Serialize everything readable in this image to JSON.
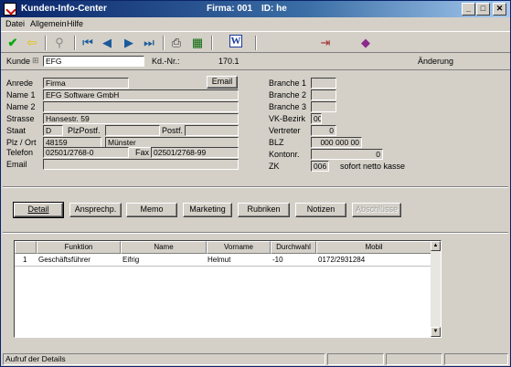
{
  "window": {
    "title": "Kunden-Info-Center",
    "firma": "Firma: 001",
    "id": "ID: he",
    "buttons": [
      "_",
      "□",
      "✕"
    ]
  },
  "menu": [
    "Datei",
    "Allgemein",
    "Hilfe"
  ],
  "header": {
    "kunde_label": "Kunde",
    "kunde_value": "EFG",
    "kdnr_label": "Kd.-Nr.:",
    "kdnr_value": "170.1",
    "mode": "Änderung"
  },
  "form": {
    "anrede_label": "Anrede",
    "anrede": "Firma",
    "email_button": "Email",
    "name1_label": "Name 1",
    "name1": "EFG Software GmbH",
    "name2_label": "Name 2",
    "name2": "",
    "strasse_label": "Strasse",
    "strasse": "Hansestr. 59",
    "staat_label": "Staat",
    "staat": "D",
    "plzpostf_label": "PlzPostf.",
    "plzpostf": "",
    "postf_label": "Postf.",
    "postf": "",
    "plzort_label": "Plz / Ort",
    "plz": "48159",
    "ort": "Münster",
    "telefon_label": "Telefon",
    "telefon": "02501/2768-0",
    "fax_label": "Fax",
    "fax": "02501/2768-99",
    "email_label": "Email",
    "email": "",
    "branche1_label": "Branche 1",
    "branche1": "",
    "branche2_label": "Branche 2",
    "branche2": "",
    "branche3_label": "Branche 3",
    "branche3": "",
    "vkbezirk_label": "VK-Bezirk",
    "vkbezirk": "00",
    "vertreter_label": "Vertreter",
    "vertreter": "0",
    "blz_label": "BLZ",
    "blz": "000 000 00",
    "kontonr_label": "Kontonr.",
    "kontonr": "0",
    "zk_label": "ZK",
    "zk": "006",
    "zk_text": "sofort netto kasse"
  },
  "tabs": [
    "Detail",
    "Ansprechp.",
    "Memo",
    "Marketing",
    "Rubriken",
    "Notizen",
    "Abschlüsse"
  ],
  "grid": {
    "columns": [
      "",
      "Funktion",
      "Name",
      "Vorname",
      "Durchwahl",
      "Mobil"
    ],
    "rows": [
      [
        "1",
        "Geschäftsführer",
        "Eifrig",
        "Helmut",
        "-10",
        "0172/2931284"
      ]
    ]
  },
  "status": {
    "text": "Aufruf der Details"
  }
}
